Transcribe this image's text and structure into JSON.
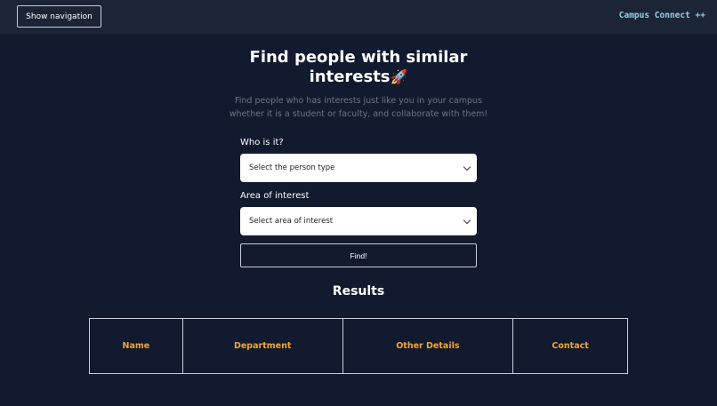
{
  "topbar": {
    "nav_button_label": "Show navigation",
    "brand": "Campus Connect ++"
  },
  "hero": {
    "title_line1": "Find people with similar",
    "title_line2": "interests",
    "title_emoji": "🚀",
    "subtitle_line1": "Find people who has interests just like you in your campus",
    "subtitle_line2": "whether it is a student or faculty, and collaborate with them!"
  },
  "form": {
    "person_label": "Who is it?",
    "person_select_value": "Select the person type",
    "interest_label": "Area of interest",
    "interest_select_value": "Select area of interest",
    "find_button_label": "Find!"
  },
  "results": {
    "title": "Results",
    "columns": [
      "Name",
      "Department",
      "Other Details",
      "Contact"
    ]
  },
  "colors": {
    "background": "#111a2e",
    "topbar": "#1c2536",
    "brand": "#8fd3e0",
    "column_header": "#f0a53a",
    "subtitle": "#6e7585"
  }
}
